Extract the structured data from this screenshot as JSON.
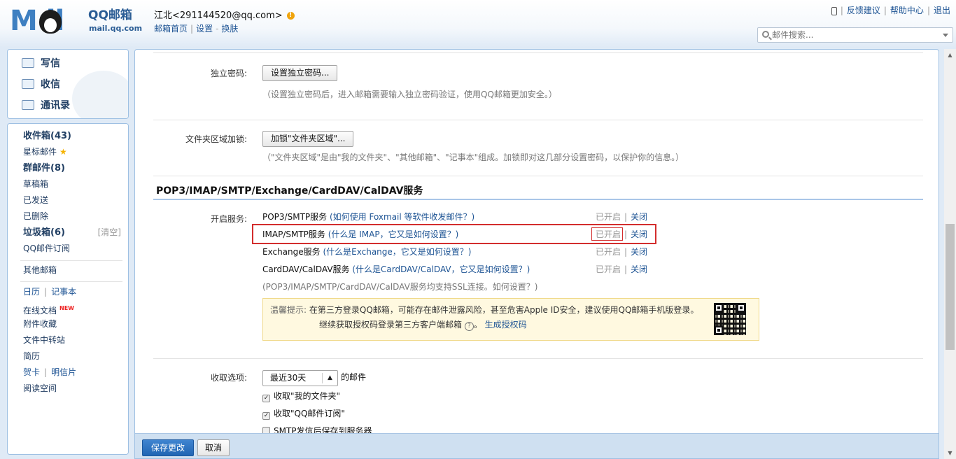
{
  "header": {
    "logo_brand": "QQ邮箱",
    "logo_domain": "mail.qq.com",
    "user_name": "江北<291144520@qq.com>",
    "home_link": "邮箱首页",
    "settings_link": "设置",
    "skin_link": "换肤",
    "feedback": "反馈建议",
    "help": "帮助中心",
    "logout": "退出",
    "search_placeholder": "邮件搜索..."
  },
  "quick": {
    "write": "写信",
    "receive": "收信",
    "contacts": "通讯录"
  },
  "folders": {
    "inbox": "收件箱(43)",
    "starred": "星标邮件",
    "group": "群邮件(8)",
    "drafts": "草稿箱",
    "sent": "已发送",
    "deleted": "已删除",
    "spam": "垃圾箱(6)",
    "spam_clear": "[清空]",
    "subscribe": "QQ邮件订阅",
    "other": "其他邮箱",
    "calendar": "日历",
    "notes": "记事本",
    "docs": "在线文档",
    "docs_badge": "NEW",
    "attachments": "附件收藏",
    "transfer": "文件中转站",
    "resume": "简历",
    "cards": "贺卡",
    "postcards": "明信片",
    "reading": "阅读空间"
  },
  "settings": {
    "pwd_label": "独立密码:",
    "pwd_button": "设置独立密码...",
    "pwd_hint": "（设置独立密码后，进入邮箱需要输入独立密码验证，使用QQ邮箱更加安全。）",
    "lock_label": "文件夹区域加锁:",
    "lock_button": "加锁\"文件夹区域\"...",
    "lock_hint": "（\"文件夹区域\"是由\"我的文件夹\"、\"其他邮箱\"、\"记事本\"组成。加锁即对这几部分设置密码，以保护你的信息。）",
    "section_title": "POP3/IMAP/SMTP/Exchange/CardDAV/CalDAV服务",
    "enable_label": "开启服务:",
    "services": [
      {
        "name": "POP3/SMTP服务",
        "q": "(如何使用 Foxmail 等软件收发邮件？)",
        "status": "已开启",
        "action": "关闭"
      },
      {
        "name": "IMAP/SMTP服务",
        "q": "(什么是 IMAP，它又是如何设置？)",
        "status": "已开启",
        "action": "关闭"
      },
      {
        "name": "Exchange服务",
        "q": "(什么是Exchange，它又是如何设置？)",
        "status": "已开启",
        "action": "关闭"
      },
      {
        "name": "CardDAV/CalDAV服务",
        "q": "(什么是CardDAV/CalDAV，它又是如何设置？)",
        "status": "已开启",
        "action": "关闭"
      }
    ],
    "ssl_hint": "(POP3/IMAP/SMTP/CardDAV/CalDAV服务均支持SSL连接。如何设置？)",
    "tip_label": "温馨提示:",
    "tip_line1": "在第三方登录QQ邮箱，可能存在邮件泄露风险，甚至危害Apple ID安全，建议使用QQ邮箱手机版登录。",
    "tip_line2": "继续获取授权码登录第三方客户端邮箱",
    "tip_help": "?",
    "tip_link": "生成授权码",
    "fetch_label": "收取选项:",
    "fetch_select": "最近30天",
    "fetch_suffix": "的邮件",
    "opt1": "收取\"我的文件夹\"",
    "opt2": "收取\"QQ邮件订阅\"",
    "opt3": "SMTP发信后保存到服务器"
  },
  "footer": {
    "save": "保存更改",
    "cancel": "取消"
  }
}
